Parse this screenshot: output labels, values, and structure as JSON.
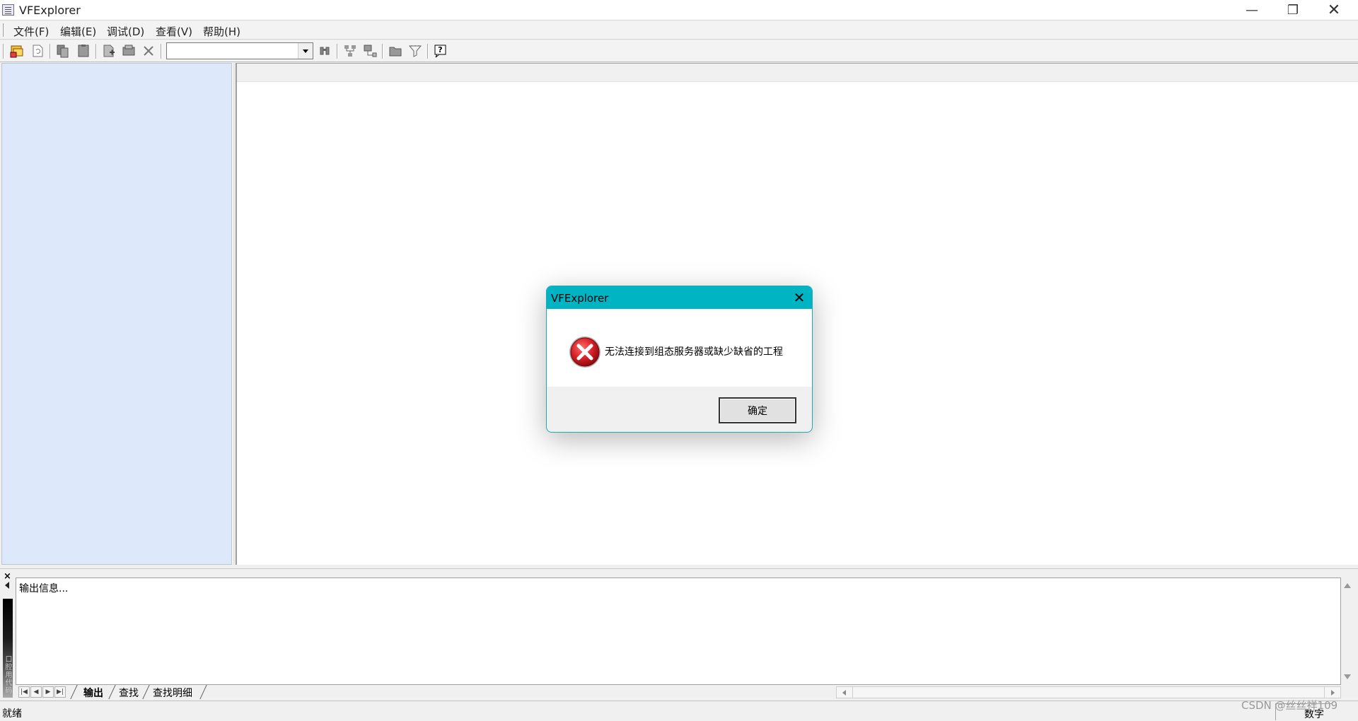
{
  "window": {
    "title": "VFExplorer",
    "minimize": "—",
    "restore": "❐",
    "close": "✕"
  },
  "menu": {
    "items": [
      "文件(F)",
      "编辑(E)",
      "调试(D)",
      "查看(V)",
      "帮助(H)"
    ]
  },
  "toolbar": {
    "combo_value": ""
  },
  "output": {
    "text": "输出信息...",
    "grip_label": "口腔用代码",
    "tabs": [
      "输出",
      "查找",
      "查找明细"
    ]
  },
  "status": {
    "text": "就绪",
    "numlock": "数字"
  },
  "watermark": "CSDN @丝丝祥109",
  "dialog": {
    "title": "VFExplorer",
    "message": "无法连接到组态服务器或缺少缺省的工程",
    "ok_label": "确定"
  },
  "colors": {
    "dialog_titlebar": "#00b4c4",
    "left_pane": "#dde9fb",
    "error_icon": "#d61f26"
  }
}
